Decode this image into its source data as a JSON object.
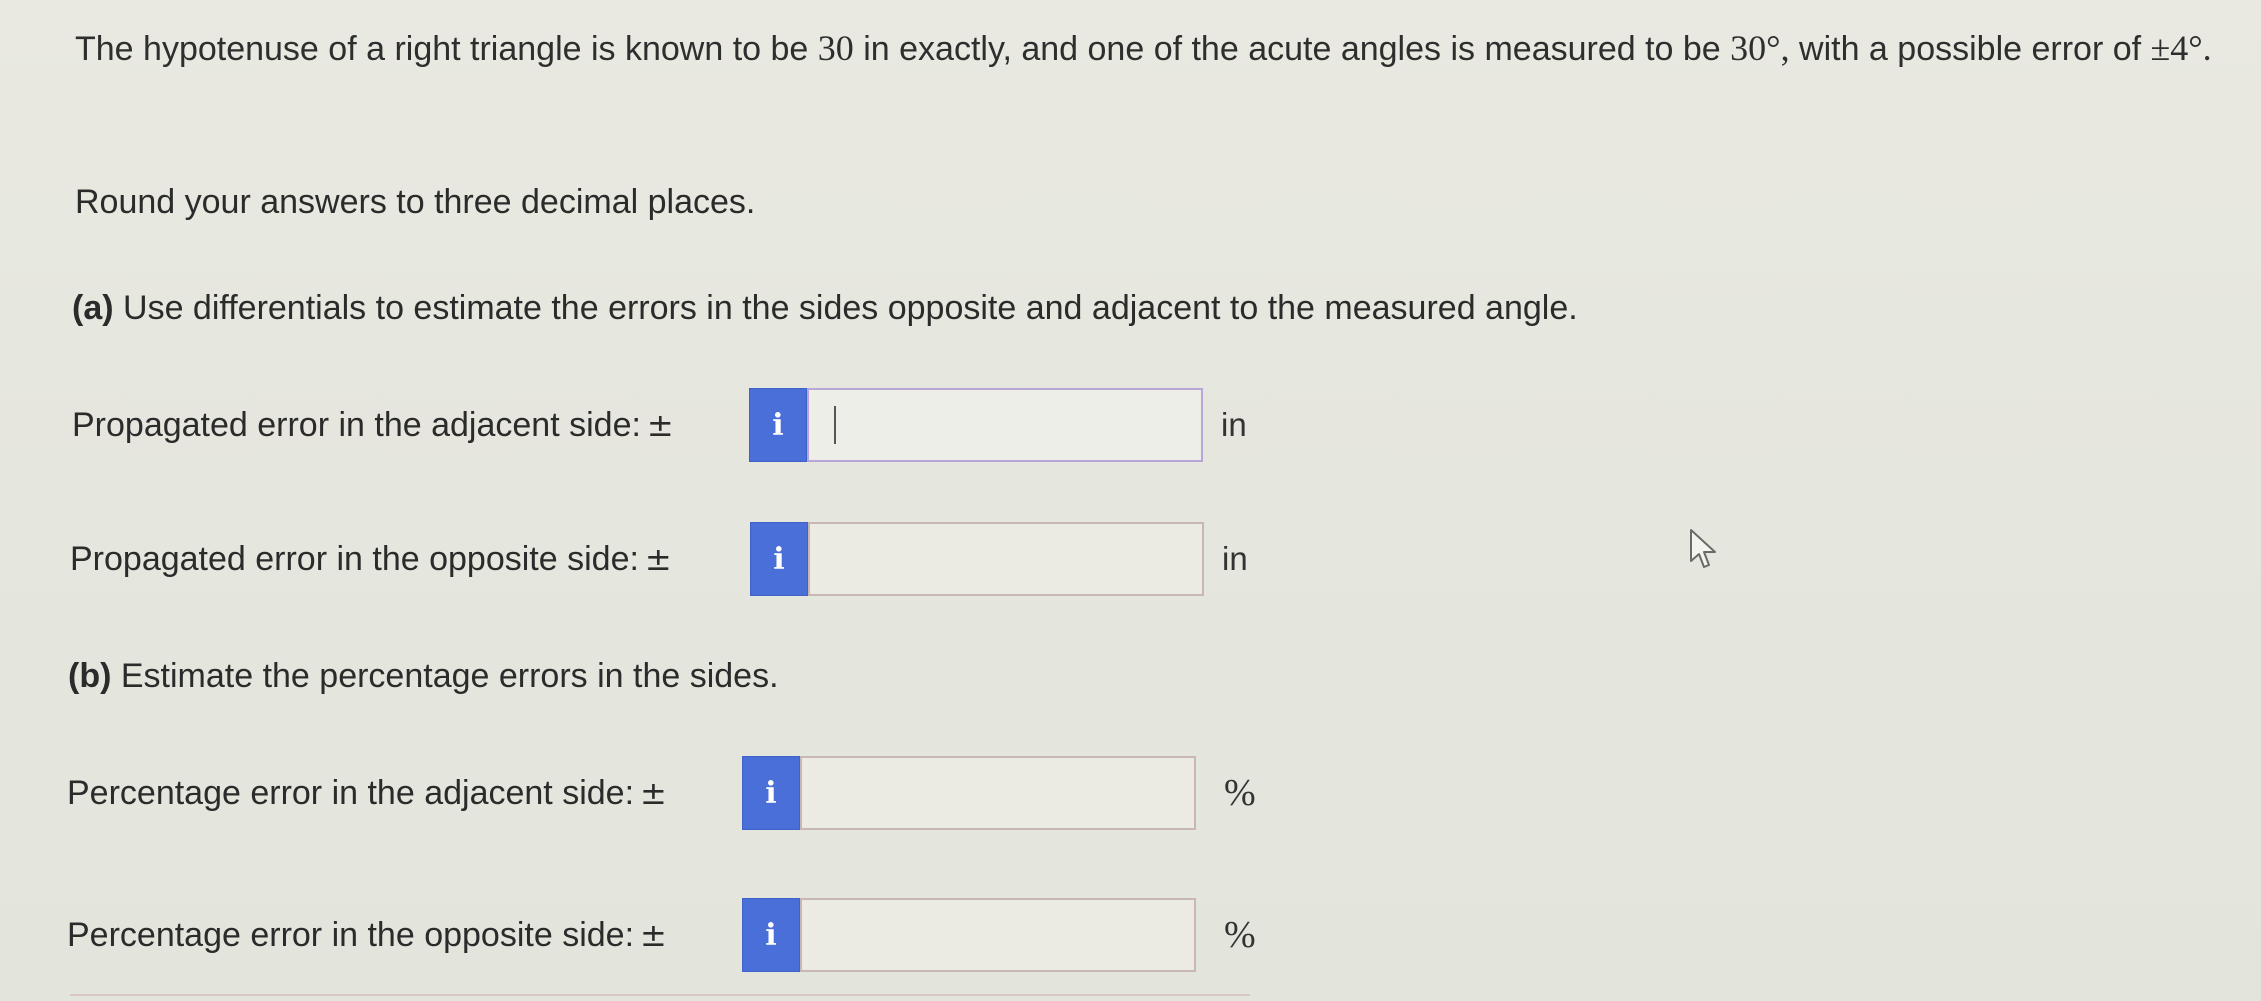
{
  "problem": {
    "text_before_30": "The hypotenuse of a right triangle is known to be ",
    "hypotenuse_value": "30",
    "text_after_30": " in exactly, and one of the acute angles is measured to be ",
    "angle_value": "30°,",
    "text_after_angle": "  with a possible error of ",
    "error_value": "±4°",
    "text_end": ".",
    "rounding": "Round your answers to three decimal places."
  },
  "part_a": {
    "tag": "(a)",
    "text": " Use differentials to estimate the errors in the sides opposite and adjacent to the measured angle."
  },
  "part_b": {
    "tag": "(b)",
    "text": " Estimate the percentage errors in the sides."
  },
  "rows": [
    {
      "label": "Propagated error in the adjacent side:",
      "pm": "±",
      "info": "i",
      "value": "",
      "unit": "in"
    },
    {
      "label": "Propagated error in the opposite side:",
      "pm": "±",
      "info": "i",
      "value": "",
      "unit": "in"
    },
    {
      "label": "Percentage error in the adjacent side:",
      "pm": "±",
      "info": "i",
      "value": "",
      "unit": "%"
    },
    {
      "label": "Percentage error in the opposite side:",
      "pm": "±",
      "info": "i",
      "value": "",
      "unit": "%"
    }
  ],
  "colors": {
    "info_button": "#4a6fd8",
    "background": "#e6e6dd",
    "input_border": "#c9b8b2",
    "active_input_border": "#b9a6d8"
  },
  "icons": {
    "info": "info-icon",
    "cursor": "mouse-pointer-icon"
  }
}
